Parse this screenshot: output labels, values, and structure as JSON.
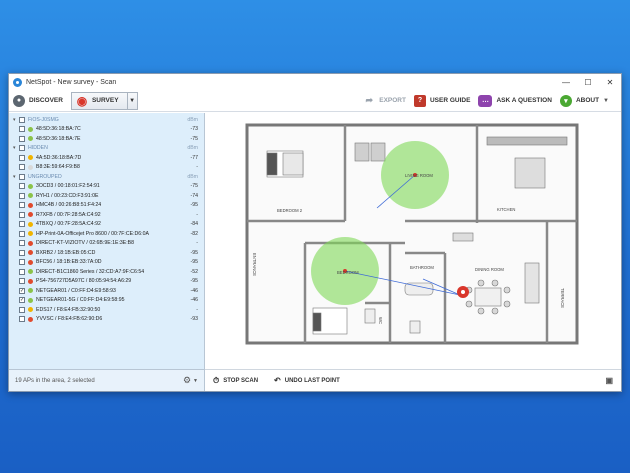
{
  "window": {
    "title": "NetSpot - New survey - Scan",
    "controls": [
      "—",
      "☐",
      "✕"
    ]
  },
  "toolbar": {
    "discover_label": "DISCOVER",
    "survey_label": "SURVEY",
    "export_label": "EXPORT",
    "user_guide_label": "USER GUIDE",
    "ask_label": "ASK A QUESTION",
    "about_label": "ABOUT"
  },
  "ap_list": {
    "groups": [
      {
        "name": "FiOS-J0SMG",
        "items": [
          {
            "name": "48:5D:36:18:BA:7C",
            "dbm": "-73",
            "checked": false,
            "color": "#8bc34a"
          },
          {
            "name": "48:5D:36:18:BA:7E",
            "dbm": "-75",
            "checked": false,
            "color": "#8bc34a"
          }
        ]
      },
      {
        "name": "HIDDEN",
        "items": [
          {
            "name": "4A:5D:36:18:BA:7D",
            "dbm": "-77",
            "checked": false,
            "color": "#f0b400"
          },
          {
            "name": "B8:3E:59:64:F9:B8",
            "dbm": "-",
            "checked": false,
            "color": "#d9d9d9"
          }
        ]
      },
      {
        "name": "UNGROUPED",
        "items": [
          {
            "name": "3OCD3 / 00:18:01:F2:54:91",
            "dbm": "-75",
            "checked": false,
            "color": "#8bc34a"
          },
          {
            "name": "RYH1 / 00:23:CD:F3:91:0E",
            "dbm": "-74",
            "checked": false,
            "color": "#8bc34a"
          },
          {
            "name": "HMC4B / 00:26:B8:51:F4:24",
            "dbm": "-95",
            "checked": false,
            "color": "#e04b2e"
          },
          {
            "name": "R7XFB / 00:7F:28:5A:C4:92",
            "dbm": "-",
            "checked": false,
            "color": "#e04b2e"
          },
          {
            "name": "4TBXQ / 00:7F:28:5A:C4:92",
            "dbm": "-84",
            "checked": false,
            "color": "#f0b400"
          },
          {
            "name": "HP-Print-0A-Officejet Pro 8600 / 00:7F:CE:D6:0A",
            "dbm": "-82",
            "checked": false,
            "color": "#f0b400"
          },
          {
            "name": "DIRECT-KT-VIZIOTV / 02:6B:9E:1E:3E:B8",
            "dbm": "-",
            "checked": false,
            "color": "#e04b2e"
          },
          {
            "name": "BXRB2 / 18:1B:EB:05:CD",
            "dbm": "-95",
            "checked": false,
            "color": "#e04b2e"
          },
          {
            "name": "BFC56 / 18:1B:EB:33:7A:0D",
            "dbm": "-95",
            "checked": false,
            "color": "#e04b2e"
          },
          {
            "name": "DIRECT-B1C1860 Series / 32:CD:A7:9F:C6:54",
            "dbm": "-52",
            "checked": false,
            "color": "#8bc34a"
          },
          {
            "name": "PS4-756727D5A97C / 80:05:94:54:A6:29",
            "dbm": "-95",
            "checked": false,
            "color": "#e04b2e"
          },
          {
            "name": "NETGEAR01 / C0:FF:D4:E9:58:93",
            "dbm": "-46",
            "checked": true,
            "color": "#8bc34a"
          },
          {
            "name": "NETGEAR01-5G / C0:FF:D4:E9:58:95",
            "dbm": "-46",
            "checked": true,
            "color": "#8bc34a"
          },
          {
            "name": "EDS17 / F8:E4:FB:32:90:50",
            "dbm": "-",
            "checked": false,
            "color": "#f0b400"
          },
          {
            "name": "YVVSC / F8:E4:FB:62:90:D6",
            "dbm": "-93",
            "checked": false,
            "color": "#e04b2e"
          }
        ]
      }
    ],
    "dbm_header": "dBm"
  },
  "sidebar_footer": {
    "status": "19 APs in the area, 2 selected"
  },
  "bottom_bar": {
    "stop_scan": "STOP SCAN",
    "undo": "UNDO LAST POINT"
  },
  "floorplan": {
    "rooms": [
      "BEDROOM 2",
      "LIVING ROOM",
      "KITCHEN",
      "ENTRANCE",
      "BATHROOM",
      "DINING ROOM",
      "TERRACE",
      "WC",
      "BEDROOM"
    ]
  }
}
